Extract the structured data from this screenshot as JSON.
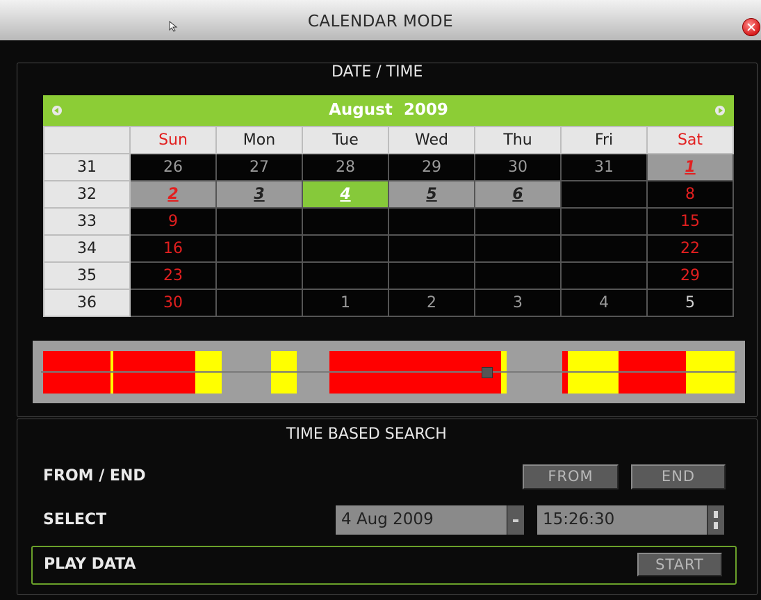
{
  "window": {
    "title": "CALENDAR MODE"
  },
  "date_time": {
    "legend": "DATE / TIME",
    "month": "August",
    "year": "2009",
    "weekdays": [
      "Sun",
      "Mon",
      "Tue",
      "Wed",
      "Thu",
      "Fri",
      "Sat"
    ],
    "weeks": [
      {
        "num": "31",
        "days": [
          "26",
          "27",
          "28",
          "29",
          "30",
          "31",
          "1"
        ]
      },
      {
        "num": "32",
        "days": [
          "2",
          "3",
          "4",
          "5",
          "6",
          "",
          ""
        ]
      },
      {
        "num": "33",
        "days": [
          "9",
          "",
          "",
          "",
          "",
          "",
          "15"
        ]
      },
      {
        "num": "34",
        "days": [
          "16",
          "",
          "",
          "",
          "",
          "",
          "22"
        ]
      },
      {
        "num": "35",
        "days": [
          "23",
          "",
          "",
          "",
          "",
          "",
          "29"
        ]
      },
      {
        "num": "36",
        "days": [
          "30",
          "",
          "1",
          "2",
          "3",
          "4",
          "5"
        ]
      }
    ],
    "week32_sat": "8",
    "selected_day": "4"
  },
  "colors": {
    "accent_green": "#8ccd36",
    "record_red": "#ff0000",
    "record_yellow": "#ffff00",
    "weekend_red": "#e21f1f"
  },
  "time_based_search": {
    "legend": "TIME BASED SEARCH",
    "from_end_label": "FROM / END",
    "from_button": "FROM",
    "end_button": "END",
    "select_label": "SELECT",
    "date_value": "4 Aug 2009",
    "time_value": "15:26:30",
    "play_label": "PLAY DATA",
    "start_button": "START"
  }
}
